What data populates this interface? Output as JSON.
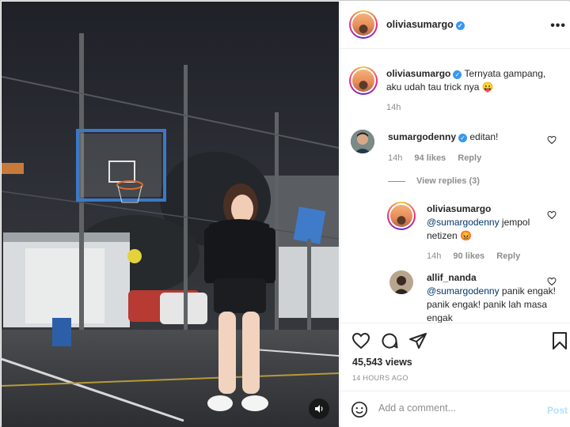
{
  "post": {
    "author": "oliviasumargo",
    "verified_mark": "✓",
    "more_label": "•••"
  },
  "caption": {
    "username": "oliviasumargo",
    "text": "Ternyata gampang, aku udah tau trick nya 😛",
    "time": "14h"
  },
  "comments": [
    {
      "username": "sumargodenny",
      "text": "editan!",
      "time": "14h",
      "likes": "94 likes",
      "reply_label": "Reply",
      "view_replies": "View replies (3)"
    },
    {
      "username": "oliviasumargo",
      "mention": "@sumargodenny",
      "text": "jempol netizen 😡",
      "time": "14h",
      "likes": "90 likes",
      "reply_label": "Reply"
    },
    {
      "username": "allif_nanda",
      "mention": "@sumargodenny",
      "text": "panik engak! panik engak! panik lah masa engak"
    }
  ],
  "actions": {
    "views": "45,543 views",
    "time_ago": "14 HOURS AGO"
  },
  "add_comment": {
    "placeholder": "Add a comment...",
    "post_label": "Post"
  },
  "icons": {
    "heart": "heart-icon",
    "comment": "comment-icon",
    "share": "share-icon",
    "save": "bookmark-icon",
    "emoji": "emoji-icon",
    "sound": "speaker-icon"
  },
  "colors": {
    "link": "#00376b",
    "verified": "#3897f0",
    "muted": "#8e8e8e",
    "post_disabled": "#b2dffc"
  }
}
